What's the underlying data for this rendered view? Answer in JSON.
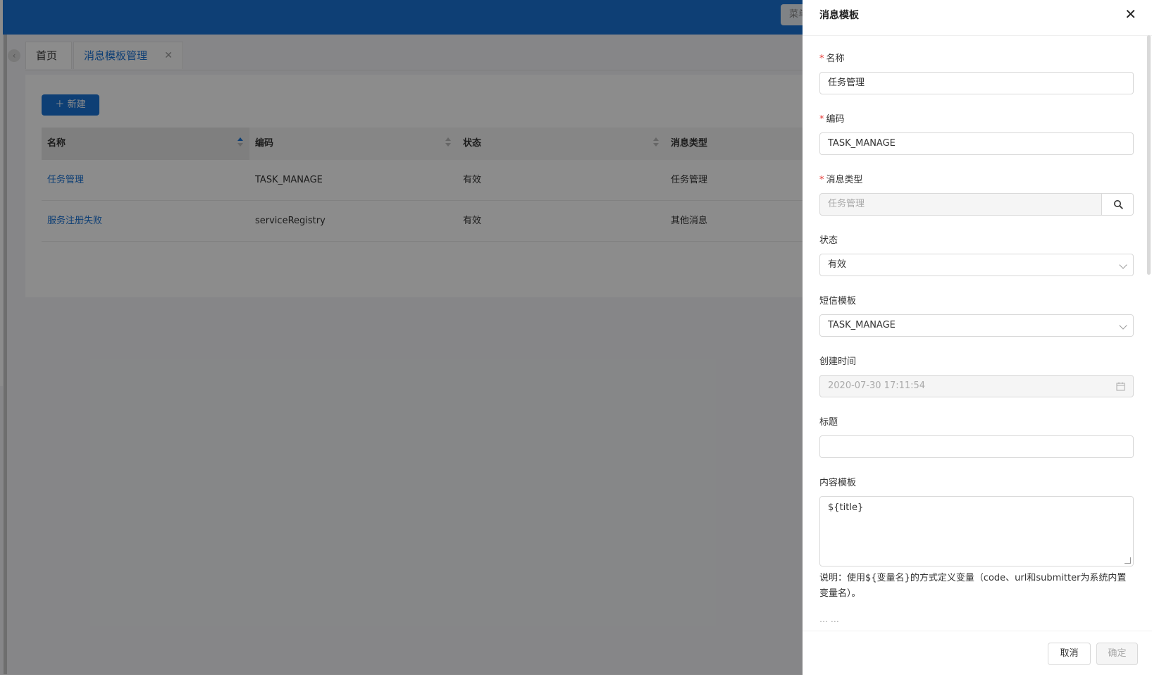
{
  "topbar": {
    "menu_label": "菜单"
  },
  "tabs": [
    {
      "label": "首页"
    },
    {
      "label": "消息模板管理",
      "close": "✕"
    }
  ],
  "toolbar": {
    "new_label": "新建"
  },
  "table": {
    "columns": [
      "名称",
      "编码",
      "状态",
      "消息类型"
    ],
    "rows": [
      {
        "name": "任务管理",
        "code": "TASK_MANAGE",
        "status": "有效",
        "type": "任务管理"
      },
      {
        "name": "服务注册失败",
        "code": "serviceRegistry",
        "status": "有效",
        "type": "其他消息"
      }
    ]
  },
  "drawer": {
    "title": "消息模板",
    "fields": {
      "name": {
        "label": "名称",
        "value": "任务管理"
      },
      "code": {
        "label": "编码",
        "value": "TASK_MANAGE"
      },
      "msg_type": {
        "label": "消息类型",
        "value": "任务管理"
      },
      "status": {
        "label": "状态",
        "value": "有效"
      },
      "sms_template": {
        "label": "短信模板",
        "value": "TASK_MANAGE"
      },
      "created_time": {
        "label": "创建时间",
        "value": "2020-07-30 17:11:54"
      },
      "title": {
        "label": "标题",
        "value": ""
      },
      "content": {
        "label": "内容模板",
        "value": "${title}"
      }
    },
    "hint": "说明：使用${变量名}的方式定义变量（code、url和submitter为系统内置变量名）。",
    "cancel_label": "取消",
    "ok_label": "确定"
  }
}
